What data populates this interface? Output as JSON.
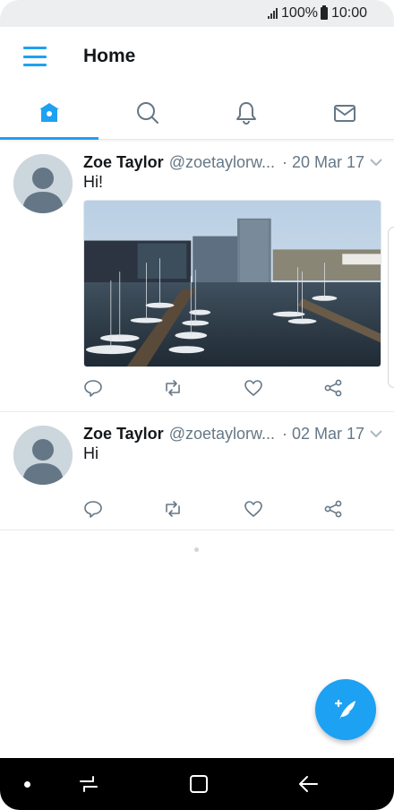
{
  "status_bar": {
    "battery": "100%",
    "time": "10:00",
    "signal_icon": "signal-icon",
    "battery_icon": "battery-icon"
  },
  "app_bar": {
    "title": "Home",
    "menu_icon": "hamburger-menu-icon"
  },
  "tabs": [
    {
      "name": "home",
      "icon": "home-icon",
      "active": true
    },
    {
      "name": "search",
      "icon": "search-icon",
      "active": false
    },
    {
      "name": "notifications",
      "icon": "bell-icon",
      "active": false
    },
    {
      "name": "messages",
      "icon": "mail-icon",
      "active": false
    }
  ],
  "tweets": [
    {
      "name": "Zoe Taylor",
      "handle": "@zoetaylorw...",
      "date": "· 20 Mar 17",
      "text": "Hi!",
      "has_media": true
    },
    {
      "name": "Zoe Taylor",
      "handle": "@zoetaylorw...",
      "date": "· 02 Mar 17",
      "text": "Hi",
      "has_media": false
    }
  ],
  "actions": [
    "reply-icon",
    "retweet-icon",
    "like-icon",
    "share-icon"
  ],
  "fab": {
    "icon": "compose-tweet-icon"
  },
  "colors": {
    "accent": "#1da1f2",
    "text": "#14171a",
    "secondary": "#657786",
    "divider": "#e6ecf0"
  }
}
